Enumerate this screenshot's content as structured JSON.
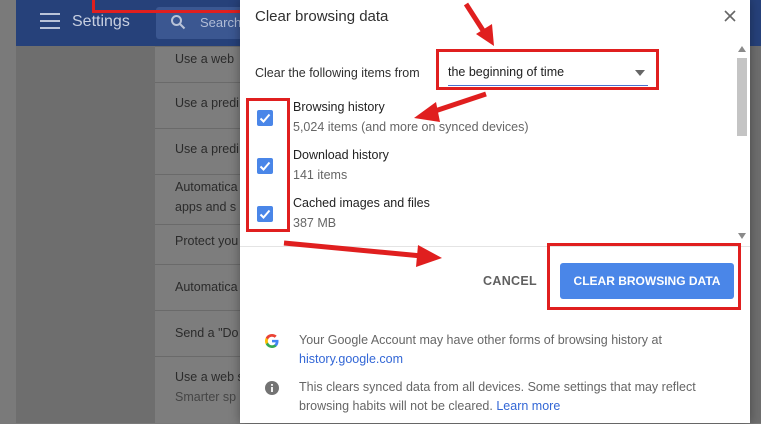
{
  "background": {
    "header_title": "Settings",
    "search_placeholder": "Search",
    "rows": [
      {
        "line1": "Use a web"
      },
      {
        "line1": "Use a predi"
      },
      {
        "line1": "Use a predi"
      },
      {
        "line1": "Automatica",
        "line2": "apps and s"
      },
      {
        "line1": "Protect you"
      },
      {
        "line1": "Automatica"
      },
      {
        "line1": "Send a \"Do"
      },
      {
        "line1": "Use a web s",
        "line2": "Smarter sp"
      }
    ]
  },
  "dialog": {
    "title": "Clear browsing data",
    "time_range_label": "Clear the following items from",
    "time_range_value": "the beginning of time",
    "items": [
      {
        "title": "Browsing history",
        "detail": "5,024 items (and more on synced devices)",
        "checked": true
      },
      {
        "title": "Download history",
        "detail": "141 items",
        "checked": true
      },
      {
        "title": "Cached images and files",
        "detail": "387 MB",
        "checked": true
      }
    ],
    "cancel_label": "CANCEL",
    "clear_label": "CLEAR BROWSING DATA",
    "footer": {
      "google_text": "Your Google Account may have other forms of browsing history at",
      "google_link": "history.google.com",
      "info_text_line1": "This clears synced data from all devices. Some settings that may reflect",
      "info_text_line2": "browsing habits will not be cleared.",
      "info_link": "Learn more"
    }
  },
  "colors": {
    "accent": "#4a86e8",
    "annotation_red": "#e01f1f",
    "link": "#3367d6"
  }
}
